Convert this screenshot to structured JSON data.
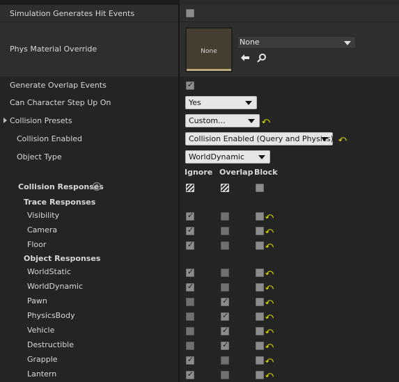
{
  "properties": {
    "sim_hit_events": {
      "label": "Simulation Generates Hit Events",
      "checked": false
    },
    "phys_material": {
      "label": "Phys Material Override",
      "thumbnail_text": "None",
      "value": "None",
      "browse_icon": "arrow-left-icon",
      "search_icon": "search-icon"
    },
    "overlap_events": {
      "label": "Generate Overlap Events",
      "checked": true
    },
    "step_up": {
      "label": "Can Character Step Up On",
      "value": "Yes"
    },
    "presets": {
      "label": "Collision Presets",
      "value": "Custom..."
    },
    "collision_enabled": {
      "label": "Collision Enabled",
      "value": "Collision Enabled (Query and Physics)"
    },
    "object_type": {
      "label": "Object Type",
      "value": "WorldDynamic"
    }
  },
  "columns": {
    "ignore": "Ignore",
    "overlap": "Overlap",
    "block": "Block"
  },
  "collision_responses": {
    "label": "Collision Responses",
    "help_icon": "?"
  },
  "trace_responses": {
    "label": "Trace Responses",
    "rows": [
      {
        "label": "Visibility",
        "ignore": true,
        "overlap": false,
        "block": false
      },
      {
        "label": "Camera",
        "ignore": true,
        "overlap": false,
        "block": false
      },
      {
        "label": "Floor",
        "ignore": true,
        "overlap": false,
        "block": false
      }
    ]
  },
  "object_responses": {
    "label": "Object Responses",
    "rows": [
      {
        "label": "WorldStatic",
        "ignore": true,
        "overlap": false,
        "block": false
      },
      {
        "label": "WorldDynamic",
        "ignore": true,
        "overlap": false,
        "block": false
      },
      {
        "label": "Pawn",
        "ignore": false,
        "overlap": true,
        "block": false
      },
      {
        "label": "PhysicsBody",
        "ignore": false,
        "overlap": true,
        "block": false
      },
      {
        "label": "Vehicle",
        "ignore": false,
        "overlap": true,
        "block": false
      },
      {
        "label": "Destructible",
        "ignore": false,
        "overlap": true,
        "block": false
      },
      {
        "label": "Grapple",
        "ignore": true,
        "overlap": false,
        "block": false
      },
      {
        "label": "Lantern",
        "ignore": true,
        "overlap": false,
        "block": false
      }
    ]
  },
  "colors": {
    "reset_arrow": "#d7d700",
    "panel_bg": "#242424",
    "row_alt_bg": "#2e2e2e"
  }
}
